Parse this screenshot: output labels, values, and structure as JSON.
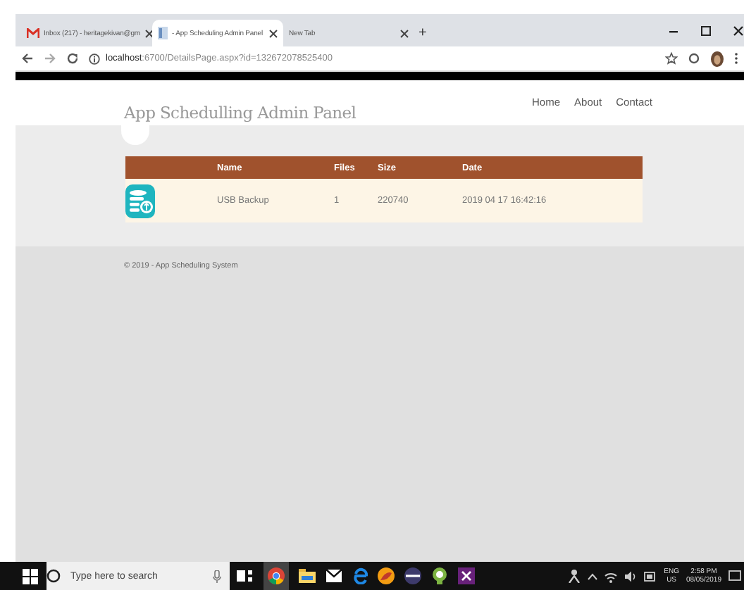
{
  "browser": {
    "tabs": [
      {
        "kind": "gmail",
        "title": "Inbox (217) - heritagekivan@gm",
        "selected": false
      },
      {
        "kind": "page",
        "title": "- App Scheduling Admin Panel",
        "selected": true
      },
      {
        "kind": "blank",
        "title": "New Tab",
        "selected": false
      }
    ],
    "new_tab": "+",
    "url_host": "localhost",
    "url_path": ":6700/DetailsPage.aspx?id=132672078525400"
  },
  "header": {
    "title": "App Schedulling Admin Panel",
    "nav": [
      "Home",
      "About",
      "Contact"
    ]
  },
  "table": {
    "columns": [
      "Name",
      "Files",
      "Size",
      "Date"
    ],
    "rows": [
      {
        "name": "USB Backup",
        "files": "1",
        "size": "220740",
        "date": "2019 04 17 16:42:16"
      }
    ]
  },
  "footer": "© 2019 - App Scheduling System",
  "taskbar": {
    "search_placeholder": "Type here to search",
    "language": [
      "ENG",
      "US"
    ],
    "time": "2:58 PM",
    "date": "08/05/2019"
  }
}
